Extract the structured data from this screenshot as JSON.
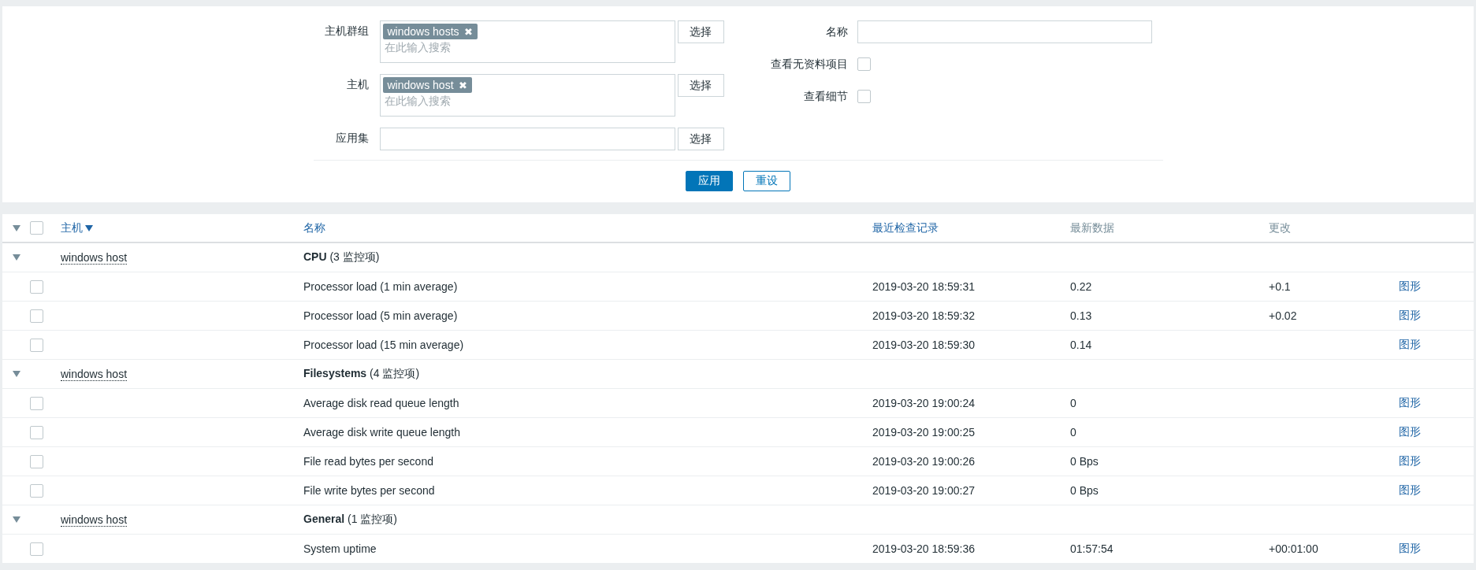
{
  "filter": {
    "fields": [
      {
        "label": "主机群组",
        "kind": "multiselect",
        "tags": [
          {
            "text": "windows hosts",
            "remove": "✖"
          }
        ],
        "placeholder": "在此输入搜索",
        "button": "选择"
      },
      {
        "label": "主机",
        "kind": "multiselect",
        "tags": [
          {
            "text": "windows host",
            "remove": "✖"
          }
        ],
        "placeholder": "在此输入搜索",
        "button": "选择"
      },
      {
        "label": "应用集",
        "kind": "text",
        "button": "选择"
      }
    ],
    "right": [
      {
        "label": "名称",
        "kind": "text"
      },
      {
        "label": "查看无资料项目",
        "kind": "checkbox",
        "checked": false
      },
      {
        "label": "查看细节",
        "kind": "checkbox",
        "checked": false
      }
    ],
    "apply": "应用",
    "reset": "重设"
  },
  "table": {
    "expanded": true,
    "checked": false,
    "columns": [
      {
        "label": "主机",
        "sortable": true,
        "sorted": true
      },
      {
        "label": "名称",
        "sortable": true,
        "sorted": false
      },
      {
        "label": "最近检查记录",
        "sortable": true,
        "sorted": false
      },
      {
        "label": "最新数据",
        "sortable": false,
        "sorted": false
      },
      {
        "label": "更改",
        "sortable": false,
        "sorted": false
      }
    ],
    "groups": [
      {
        "expanded": true,
        "host": "windows host",
        "name": "**CPU** (3 监控项)",
        "items": [
          {
            "checked": false,
            "name": "Processor load (1 min average)",
            "last_check": "2019-03-20 18:59:31",
            "latest": "0.22",
            "change": "+0.1",
            "link": "图形"
          },
          {
            "checked": false,
            "name": "Processor load (5 min average)",
            "last_check": "2019-03-20 18:59:32",
            "latest": "0.13",
            "change": "+0.02",
            "link": "图形"
          },
          {
            "checked": false,
            "name": "Processor load (15 min average)",
            "last_check": "2019-03-20 18:59:30",
            "latest": "0.14",
            "link": "图形"
          }
        ]
      },
      {
        "expanded": true,
        "host": "windows host",
        "name": "**Filesystems** (4 监控项)",
        "items": [
          {
            "checked": false,
            "name": "Average disk read queue length",
            "last_check": "2019-03-20 19:00:24",
            "latest": "0",
            "link": "图形"
          },
          {
            "checked": false,
            "name": "Average disk write queue length",
            "last_check": "2019-03-20 19:00:25",
            "latest": "0",
            "link": "图形"
          },
          {
            "checked": false,
            "name": "File read bytes per second",
            "last_check": "2019-03-20 19:00:26",
            "latest": "0 Bps",
            "link": "图形"
          },
          {
            "checked": false,
            "name": "File write bytes per second",
            "last_check": "2019-03-20 19:00:27",
            "latest": "0 Bps",
            "link": "图形"
          }
        ]
      },
      {
        "expanded": true,
        "host": "windows host",
        "name": "**General** (1 监控项)",
        "items": [
          {
            "checked": false,
            "name": "System uptime",
            "last_check": "2019-03-20 18:59:36",
            "latest": "01:57:54",
            "change": "+00:01:00",
            "link": "图形"
          }
        ]
      }
    ]
  }
}
